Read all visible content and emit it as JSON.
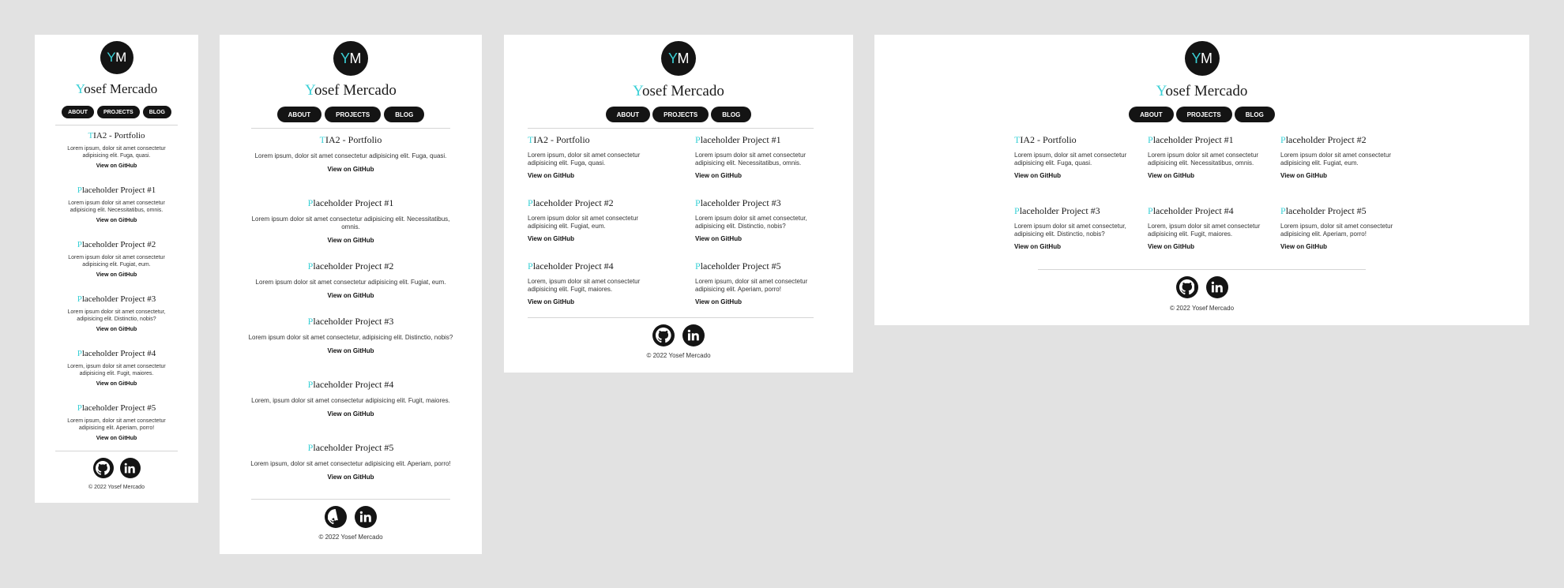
{
  "site": {
    "initials_first": "Y",
    "initials_rest": "M",
    "name_first": "Y",
    "name_rest": "osef Mercado",
    "nav": [
      "ABOUT",
      "PROJECTS",
      "BLOG"
    ],
    "github_label": "View on GitHub",
    "copyright": "© 2022 Yosef Mercado",
    "accent_color": "#3ad0d6",
    "dark_color": "#141414"
  },
  "projects": [
    {
      "first": "T",
      "rest": "IA2 - Portfolio",
      "desc": "Lorem ipsum, dolor sit amet consectetur adipisicing elit. Fuga, quasi."
    },
    {
      "first": "P",
      "rest": "laceholder Project #1",
      "desc": "Lorem ipsum dolor sit amet consectetur adipisicing elit. Necessitatibus, omnis."
    },
    {
      "first": "P",
      "rest": "laceholder Project #2",
      "desc": "Lorem ipsum dolor sit amet consectetur adipisicing elit. Fugiat, eum."
    },
    {
      "first": "P",
      "rest": "laceholder Project #3",
      "desc": "Lorem ipsum dolor sit amet consectetur, adipisicing elit. Distinctio, nobis?"
    },
    {
      "first": "P",
      "rest": "laceholder Project #4",
      "desc": "Lorem, ipsum dolor sit amet consectetur adipisicing elit. Fugit, maiores."
    },
    {
      "first": "P",
      "rest": "laceholder Project #5",
      "desc": "Lorem ipsum, dolor sit amet consectetur adipisicing elit. Aperiam, porro!"
    }
  ],
  "social": {
    "github_icon": "github-icon",
    "linkedin_icon": "linkedin-icon"
  }
}
